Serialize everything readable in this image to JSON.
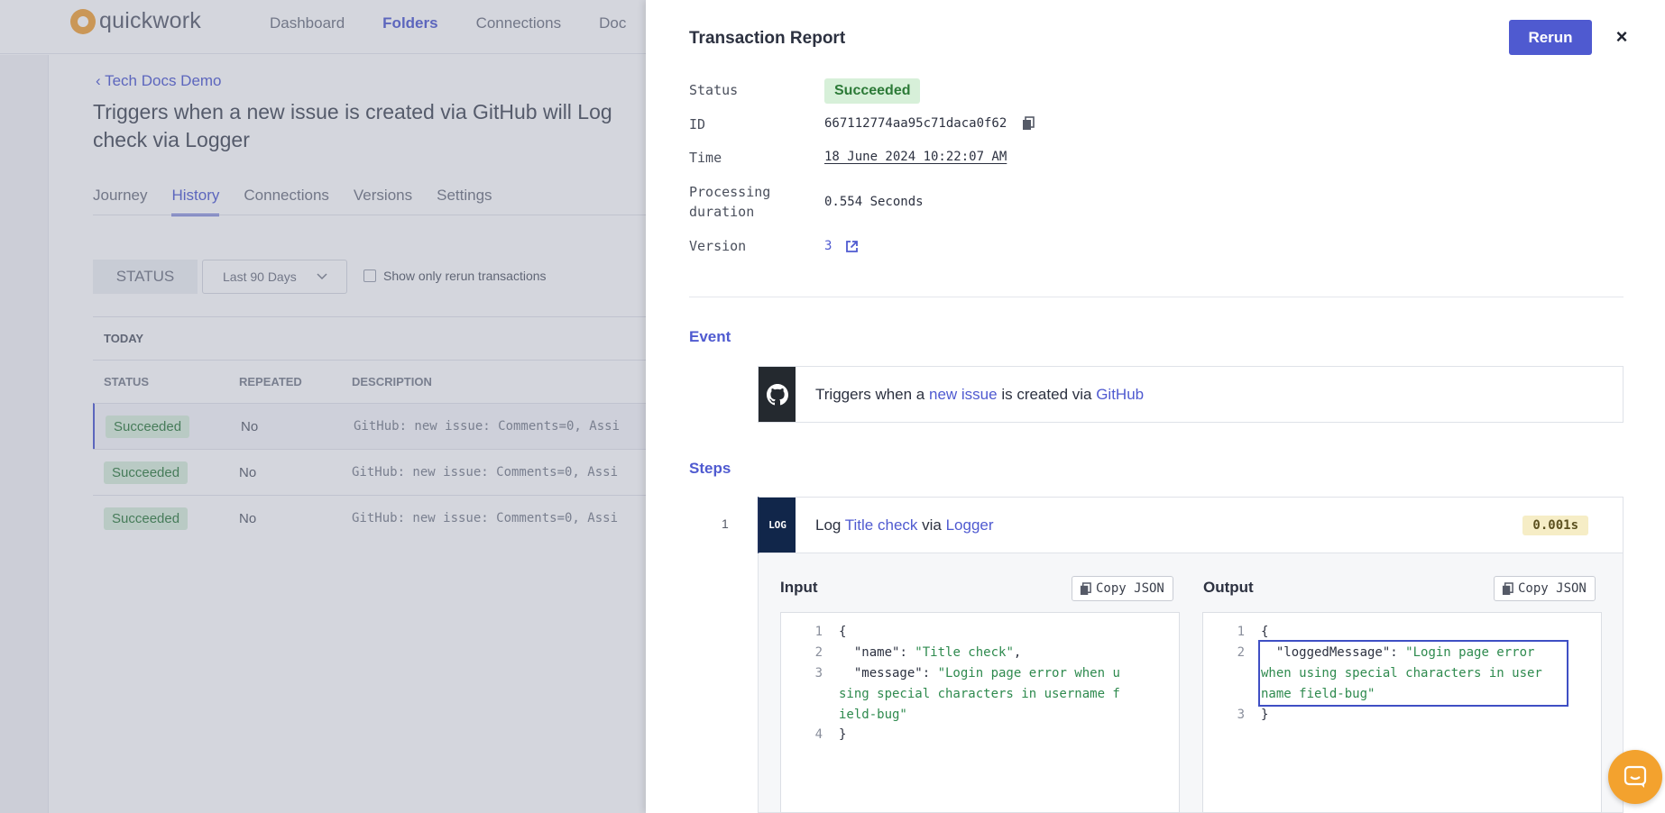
{
  "app": {
    "brand": "quickwork",
    "nav": [
      "Dashboard",
      "Folders",
      "Connections",
      "Doc"
    ],
    "active_nav": "Folders"
  },
  "page": {
    "breadcrumb": "Tech Docs Demo",
    "title_line1": "Triggers when a new issue is created via GitHub will Log",
    "title_line2": "check via Logger",
    "tabs": [
      "Journey",
      "History",
      "Connections",
      "Versions",
      "Settings"
    ],
    "active_tab": "History",
    "filters": {
      "status_label": "STATUS",
      "range_label": "Last 90 Days",
      "rerun_checkbox_label": "Show only rerun transactions"
    },
    "table": {
      "section_label": "TODAY",
      "columns": [
        "STATUS",
        "REPEATED",
        "DESCRIPTION"
      ],
      "rows": [
        {
          "status": "Succeeded",
          "repeated": "No",
          "description": "GitHub: new issue: Comments=0, Assi"
        },
        {
          "status": "Succeeded",
          "repeated": "No",
          "description": "GitHub: new issue: Comments=0, Assi"
        },
        {
          "status": "Succeeded",
          "repeated": "No",
          "description": "GitHub: new issue: Comments=0, Assi"
        }
      ]
    }
  },
  "drawer": {
    "title": "Transaction Report",
    "rerun_label": "Rerun",
    "close_label": "×",
    "meta": {
      "status_label": "Status",
      "status_value": "Succeeded",
      "id_label": "ID",
      "id_value": "667112774aa95c71daca0f62",
      "time_label": "Time",
      "time_value": "18 June 2024 10:22:07 AM",
      "duration_label_1": "Processing",
      "duration_label_2": "duration",
      "duration_value": "0.554 Seconds",
      "version_label": "Version",
      "version_value": "3"
    },
    "event": {
      "heading": "Event",
      "text_prefix": "Triggers when a ",
      "link_event": "new issue",
      "text_mid": " is created via ",
      "link_app": "GitHub"
    },
    "steps": {
      "heading": "Steps",
      "items": [
        {
          "number": "1",
          "icon_label": "LOG",
          "text_prefix": "Log ",
          "link_action": "Title check",
          "text_mid": " via ",
          "link_app": "Logger",
          "duration": "0.001s",
          "input_label": "Input",
          "output_label": "Output",
          "copy_label": "Copy JSON",
          "input_lines": {
            "l1": "{",
            "l2_key": "\"name\"",
            "l2_val": "\"Title check\"",
            "l3_key": "\"message\"",
            "l3_val_a": "\"Login page error when u",
            "l3_val_b": "sing special characters in username f",
            "l3_val_c": "ield-bug\"",
            "l4": "}"
          },
          "output_lines": {
            "l1": "{",
            "l2_key": "\"loggedMessage\"",
            "l2_val_a": "\"Login page error",
            "l2_val_b": "when using special characters in user",
            "l2_val_c": "name field-bug\"",
            "l3": "}"
          }
        }
      ]
    }
  },
  "colors": {
    "accent": "#4f5ad0",
    "success_bg": "#d7f0d9",
    "success_text": "#2c7a37",
    "json_string": "#2e8a4e",
    "chat_button": "#f3a22e"
  },
  "icons": [
    "copy-icon",
    "external-link-icon",
    "github-icon",
    "chevron-down-icon",
    "close-icon",
    "chat-icon"
  ]
}
